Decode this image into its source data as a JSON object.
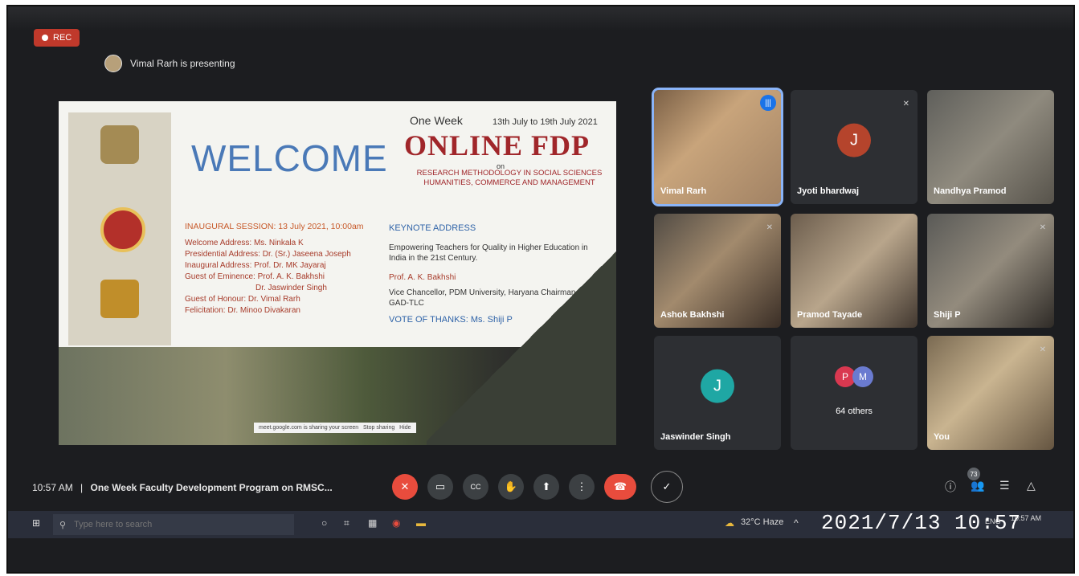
{
  "recording": {
    "label": "REC"
  },
  "presenter": {
    "text": "Vimal Rarh is presenting"
  },
  "slide": {
    "welcome": "WELCOME",
    "one_week": "One Week",
    "dates": "13th July to 19th July 2021",
    "title": "ONLINE FDP",
    "on": "on",
    "theme_line1": "RESEARCH METHODOLOGY IN SOCIAL SCIENCES",
    "theme_line2": "HUMANITIES, COMMERCE AND MANAGEMENT",
    "session": "INAUGURAL SESSION: 13 July 2021, 10:00am",
    "left_items": [
      "Welcome Address: Ms. Ninkala K",
      "Presidential Address: Dr. (Sr.) Jaseena Joseph",
      "Inaugural Address: Prof. Dr. MK Jayaraj",
      "Guest of Eminence: Prof. A. K. Bakhshi",
      "Dr. Jaswinder Singh",
      "Guest of Honour: Dr. Vimal Rarh",
      "Felicitation: Dr. Minoo Divakaran"
    ],
    "keynote_title": "KEYNOTE ADDRESS",
    "keynote_body": "Empowering Teachers for Quality in Higher Education in India in the 21st Century.",
    "keynote_prof": "Prof. A. K. Bakhshi",
    "keynote_vc": "Vice Chancellor, PDM University, Haryana Chairman, GAD-TLC",
    "vote": "VOTE OF THANKS: Ms. Shiji P",
    "share_notice": "meet.google.com is sharing your screen",
    "stop_sharing": "Stop sharing",
    "hide": "Hide"
  },
  "participants": [
    {
      "name": "Vimal Rarh"
    },
    {
      "name": "Jyoti bhardwaj",
      "initial": "J"
    },
    {
      "name": "Nandhya Pramod"
    },
    {
      "name": "Ashok Bakhshi"
    },
    {
      "name": "Pramod Tayade"
    },
    {
      "name": "Shiji P"
    },
    {
      "name": "Jaswinder Singh",
      "initial": "J"
    },
    {
      "name": "64 others",
      "initials": [
        "P",
        "M"
      ]
    },
    {
      "name": "You"
    }
  ],
  "colors": {
    "j_avatar": "#b5442c",
    "jaswinder_avatar": "#1fa7a4",
    "p_avatar": "#d93850",
    "m_avatar": "#6a7bd0"
  },
  "meeting": {
    "time": "10:57 AM",
    "separator": "|",
    "title": "One Week Faculty Development Program on RMSC..."
  },
  "people_count": "73",
  "taskbar": {
    "search_placeholder": "Type here to search",
    "weather": "32°C Haze",
    "lang": "ENG",
    "clock": "10:57 AM"
  },
  "photo_timestamp": "2021/7/13 10:57"
}
